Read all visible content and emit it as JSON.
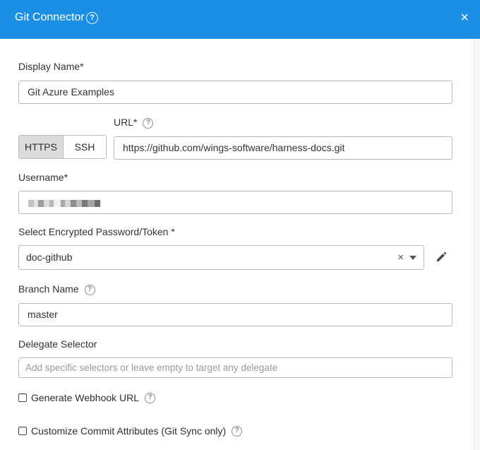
{
  "header": {
    "title": "Git Connector",
    "help_icon": "?",
    "close_icon": "×"
  },
  "display_name": {
    "label": "Display Name*",
    "value": "Git Azure Examples"
  },
  "protocol": {
    "options": [
      "HTTPS",
      "SSH"
    ],
    "selected": "HTTPS"
  },
  "url": {
    "label": "URL*",
    "value": "https://github.com/wings-software/harness-docs.git"
  },
  "username": {
    "label": "Username*"
  },
  "password": {
    "label": "Select Encrypted Password/Token *",
    "value": "doc-github",
    "clear_icon": "×"
  },
  "branch": {
    "label": "Branch Name",
    "value": "master"
  },
  "delegate": {
    "label": "Delegate Selector",
    "placeholder": "Add specific selectors or leave empty to target any delegate"
  },
  "webhook": {
    "label": "Generate Webhook URL",
    "checked": false
  },
  "commit_attrs": {
    "label": "Customize Commit Attributes (Git Sync only)",
    "checked": false
  },
  "colors": {
    "header_bg": "#1a8fe3",
    "selected_segment": "#dcdcdc"
  }
}
